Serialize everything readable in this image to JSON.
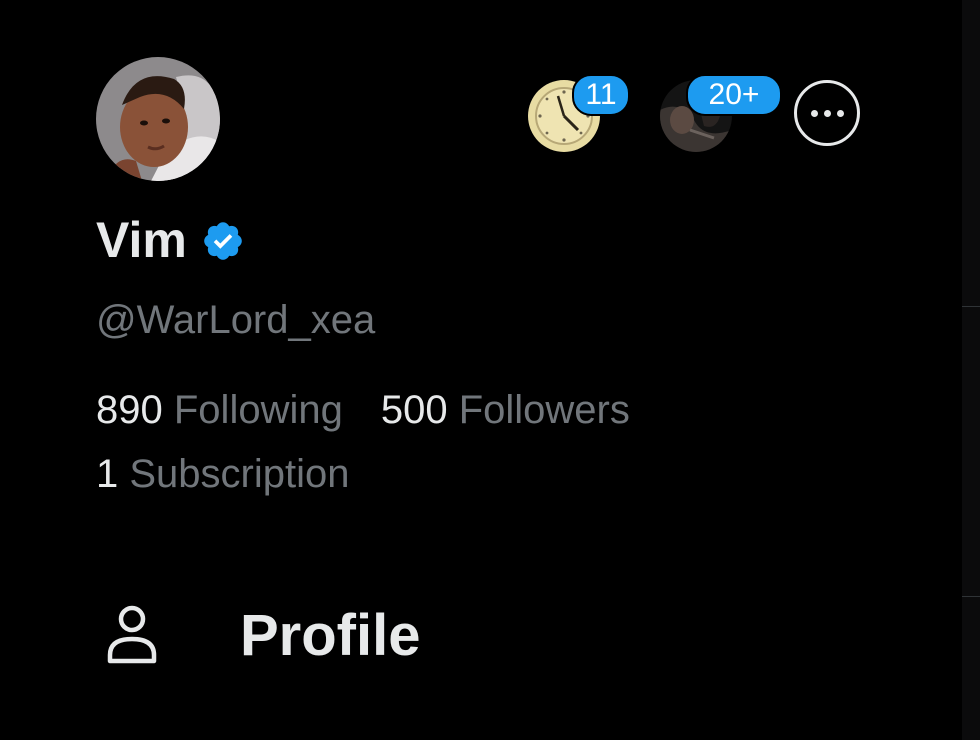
{
  "profile": {
    "name": "Vim",
    "handle": "@WarLord_xea",
    "following_count": "890",
    "following_label": "Following",
    "followers_count": "500",
    "followers_label": "Followers",
    "subscription_count": "1",
    "subscription_label": "Subscription",
    "verified_icon": "verified-badge-icon"
  },
  "accounts": [
    {
      "badge": "11",
      "image": "clock-avatar"
    },
    {
      "badge": "20+",
      "image": "dark-photo-avatar"
    }
  ],
  "more_icon": "more-horizontal-icon",
  "menu": {
    "profile_label": "Profile",
    "profile_icon": "person-icon"
  },
  "colors": {
    "background": "#000000",
    "text_primary": "#e7e9ea",
    "text_secondary": "#71767b",
    "accent": "#1d9bf0"
  }
}
